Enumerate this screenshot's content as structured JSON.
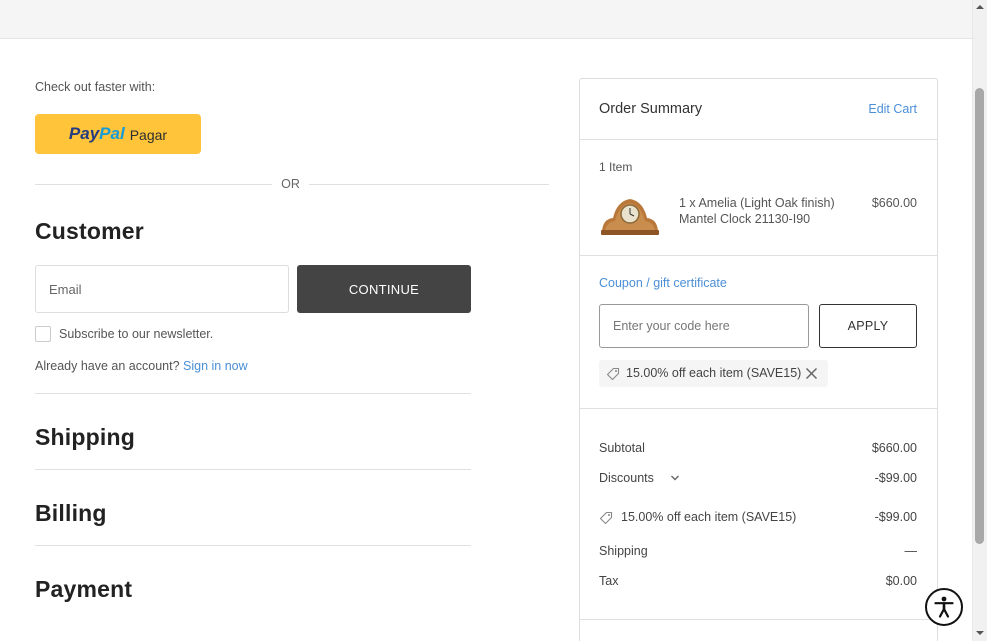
{
  "checkout": {
    "faster_label": "Check out faster with:",
    "paypal": {
      "brand_part1": "Pay",
      "brand_part2": "Pal",
      "action_label": "Pagar"
    },
    "or_label": "OR",
    "customer": {
      "title": "Customer",
      "email_placeholder": "Email",
      "continue_label": "CONTINUE",
      "newsletter_label": "Subscribe to our newsletter.",
      "account_prompt": "Already have an account?",
      "sign_in_label": "Sign in now"
    },
    "sections": [
      "Shipping",
      "Billing",
      "Payment"
    ]
  },
  "summary": {
    "title": "Order Summary",
    "edit_cart_label": "Edit Cart",
    "item_count_label": "1 Item",
    "items": [
      {
        "name": "1 x Amelia (Light Oak finish) Mantel Clock 21130-I90",
        "price": "$660.00"
      }
    ],
    "coupon_link_label": "Coupon / gift certificate",
    "coupon_placeholder": "Enter your code here",
    "apply_label": "APPLY",
    "applied_coupon": "15.00% off each item (SAVE15)",
    "totals": {
      "subtotal_label": "Subtotal",
      "subtotal_value": "$660.00",
      "discounts_label": "Discounts",
      "discounts_value": "-$99.00",
      "discount_line_label": "15.00% off each item (SAVE15)",
      "discount_line_value": "-$99.00",
      "shipping_label": "Shipping",
      "shipping_value": "—",
      "tax_label": "Tax",
      "tax_value": "$0.00"
    }
  },
  "icons": {
    "coupon_tag": "tag-icon",
    "remove_coupon": "close-icon",
    "discounts_toggle": "chevron-down-icon",
    "accessibility": "accessibility-icon"
  },
  "colors": {
    "paypal_yellow": "#ffc439",
    "paypal_dark_blue": "#253b80",
    "paypal_light_blue": "#179bd7",
    "continue_button": "#444444",
    "link_blue": "#4b8fd6"
  }
}
